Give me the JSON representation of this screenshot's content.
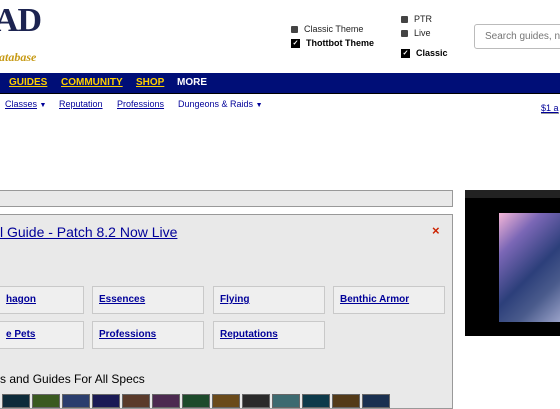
{
  "header": {
    "logo_big": "AD",
    "logo_small": "atabase",
    "options_left": [
      {
        "label": "Classic Theme",
        "checked": false
      },
      {
        "label": "Thottbot Theme",
        "checked": true
      }
    ],
    "options_right": [
      {
        "label": "PTR",
        "checked": false
      },
      {
        "label": "Live",
        "checked": false
      },
      {
        "label": "Classic",
        "checked": true
      }
    ],
    "search_placeholder": "Search guides, ne"
  },
  "nav": {
    "items": [
      "GUIDES",
      "COMMUNITY",
      "SHOP",
      "MORE"
    ]
  },
  "subnav": {
    "items": [
      "Classes",
      "Reputation",
      "Professions",
      "Dungeons & Raids"
    ],
    "promo": "$1 a"
  },
  "panel": {
    "title": "l Guide - Patch 8.2 Now Live",
    "close": "×",
    "links": [
      "hagon",
      "Essences",
      "Flying",
      "Benthic Armor",
      "e Pets",
      "Professions",
      "Reputations"
    ],
    "specs_heading": "s and Guides For All Specs"
  },
  "colors": {
    "nav_bg": "#000e77",
    "nav_link": "#ffd000",
    "link": "#000099",
    "panel_bg": "#e9e9e9"
  },
  "spec_icon_colors": [
    "#0d2b3a",
    "#3a5a20",
    "#2a3d6d",
    "#1a1a55",
    "#5a3a2a",
    "#4c2a50",
    "#1d4a2b",
    "#6a4a1a",
    "#2a2a2a",
    "#3c6a70",
    "#0d3a4a",
    "#533a18",
    "#1a3050"
  ]
}
